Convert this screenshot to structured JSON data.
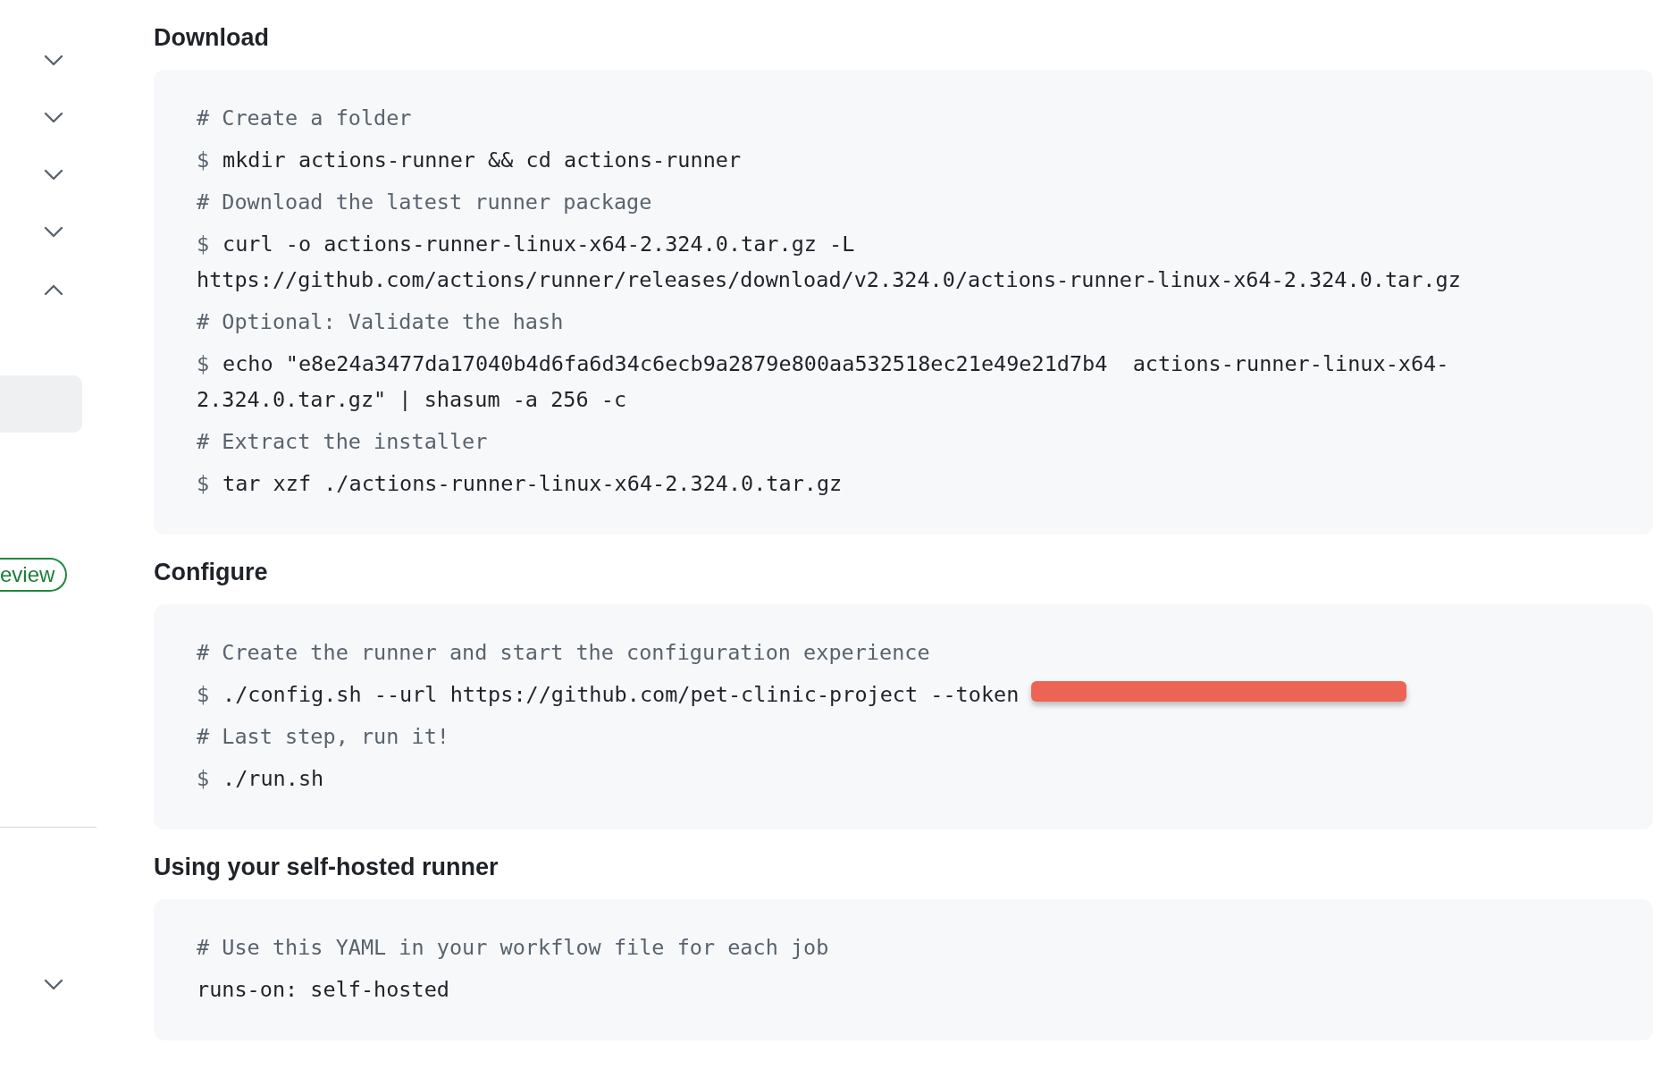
{
  "sidebar": {
    "items": [
      {
        "kind": "toggle",
        "expanded": false
      },
      {
        "kind": "toggle",
        "expanded": false
      },
      {
        "kind": "toggle",
        "expanded": false
      },
      {
        "kind": "toggle",
        "expanded": false
      },
      {
        "kind": "toggle",
        "expanded": true
      },
      {
        "kind": "highlight",
        "selected": true
      },
      {
        "kind": "badge",
        "label": "eview"
      },
      {
        "kind": "divider"
      },
      {
        "kind": "toggle",
        "expanded": false
      }
    ]
  },
  "sections": [
    {
      "title": "Download",
      "lines": [
        {
          "kind": "comment",
          "text": "# Create a folder"
        },
        {
          "kind": "command",
          "prompt": "$",
          "lines": [
            "mkdir actions-runner && cd actions-runner"
          ]
        },
        {
          "kind": "comment",
          "text": "# Download the latest runner package"
        },
        {
          "kind": "command",
          "prompt": "$",
          "lines": [
            "curl -o actions-runner-linux-x64-2.324.0.tar.gz -L",
            "https://github.com/actions/runner/releases/download/v2.324.0/actions-runner-linux-x64-2.324.0.tar.gz"
          ]
        },
        {
          "kind": "comment",
          "text": "# Optional: Validate the hash"
        },
        {
          "kind": "command",
          "prompt": "$",
          "lines": [
            "echo \"e8e24a3477da17040b4d6fa6d34c6ecb9a2879e800aa532518ec21e49e21d7b4  actions-runner-linux-x64-",
            "2.324.0.tar.gz\" | shasum -a 256 -c"
          ]
        },
        {
          "kind": "comment",
          "text": "# Extract the installer"
        },
        {
          "kind": "command",
          "prompt": "$",
          "lines": [
            "tar xzf ./actions-runner-linux-x64-2.324.0.tar.gz"
          ]
        }
      ]
    },
    {
      "title": "Configure",
      "lines": [
        {
          "kind": "comment",
          "text": "# Create the runner and start the configuration experience"
        },
        {
          "kind": "command",
          "prompt": "$",
          "lines": [
            "./config.sh --url https://github.com/pet-clinic-project --token"
          ],
          "redacted": true
        },
        {
          "kind": "comment",
          "text": "# Last step, run it!"
        },
        {
          "kind": "command",
          "prompt": "$",
          "lines": [
            "./run.sh"
          ]
        }
      ]
    },
    {
      "title": "Using your self-hosted runner",
      "lines": [
        {
          "kind": "comment",
          "text": "# Use this YAML in your workflow file for each job"
        },
        {
          "kind": "plain",
          "lines": [
            "runs-on: self-hosted"
          ]
        }
      ]
    }
  ]
}
